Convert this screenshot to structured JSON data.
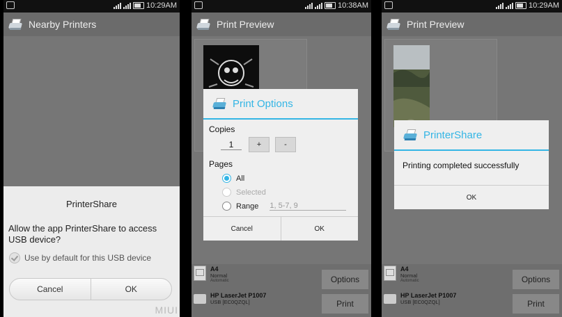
{
  "status_bar": {
    "time_1": "10:29AM",
    "time_2": "10:38AM",
    "time_3": "10:29AM"
  },
  "screen1": {
    "title": "Nearby Printers",
    "dialog": {
      "title": "PrinterShare",
      "message": "Allow the app PrinterShare to access USB device?",
      "checkbox_label": "Use by default for this USB device",
      "cancel_label": "Cancel",
      "ok_label": "OK"
    },
    "watermark": "MIUI"
  },
  "screen2": {
    "title": "Print Preview",
    "dialog": {
      "title": "Print Options",
      "copies_label": "Copies",
      "copies_value": "1",
      "plus_label": "+",
      "minus_label": "-",
      "pages_label": "Pages",
      "option_all": "All",
      "option_selected": "Selected",
      "option_range": "Range",
      "range_placeholder": "1, 5-7, 9",
      "cancel_label": "Cancel",
      "ok_label": "OK"
    },
    "paper": {
      "size": "A4",
      "quality": "Normal",
      "mode": "Automatic"
    },
    "printer": {
      "name": "HP LaserJet P1007",
      "port": "USB [EC0QZQL]"
    },
    "options_label": "Options",
    "print_label": "Print"
  },
  "screen3": {
    "title": "Print Preview",
    "dialog": {
      "title": "PrinterShare",
      "message": "Printing completed successfully",
      "ok_label": "OK"
    },
    "paper": {
      "size": "A4",
      "quality": "Normal",
      "mode": "Automatic"
    },
    "printer": {
      "name": "HP LaserJet P1007",
      "port": "USB [EC0QZQL]"
    },
    "options_label": "Options",
    "print_label": "Print"
  },
  "colors": {
    "accent": "#33b5e5",
    "dim_background": "#767676"
  }
}
